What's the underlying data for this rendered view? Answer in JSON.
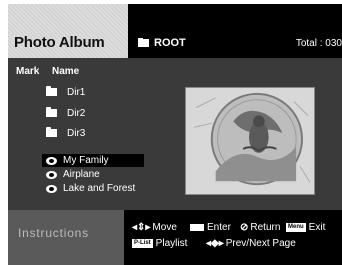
{
  "header": {
    "title": "Photo Album",
    "path": "ROOT",
    "total": "Total : 030"
  },
  "list": {
    "col_mark": "Mark",
    "col_name": "Name",
    "folders": [
      "Dir1",
      "Dir2",
      "Dir3"
    ],
    "items": [
      {
        "label": "My Family",
        "selected": true
      },
      {
        "label": "Airplane",
        "selected": false
      },
      {
        "label": "Lake and Forest",
        "selected": false
      }
    ]
  },
  "instructions": {
    "label": "Instructions",
    "move": "Move",
    "enter": "Enter",
    "return": "Return",
    "menu_key": "Menu",
    "exit": "Exit",
    "plist_key": "P-List",
    "playlist": "Playlist",
    "prevnext": "Prev/Next Page"
  },
  "colors": {
    "panel": "#3a3a3a",
    "header_black": "#000000",
    "instr_grey": "#5a5a5a"
  }
}
